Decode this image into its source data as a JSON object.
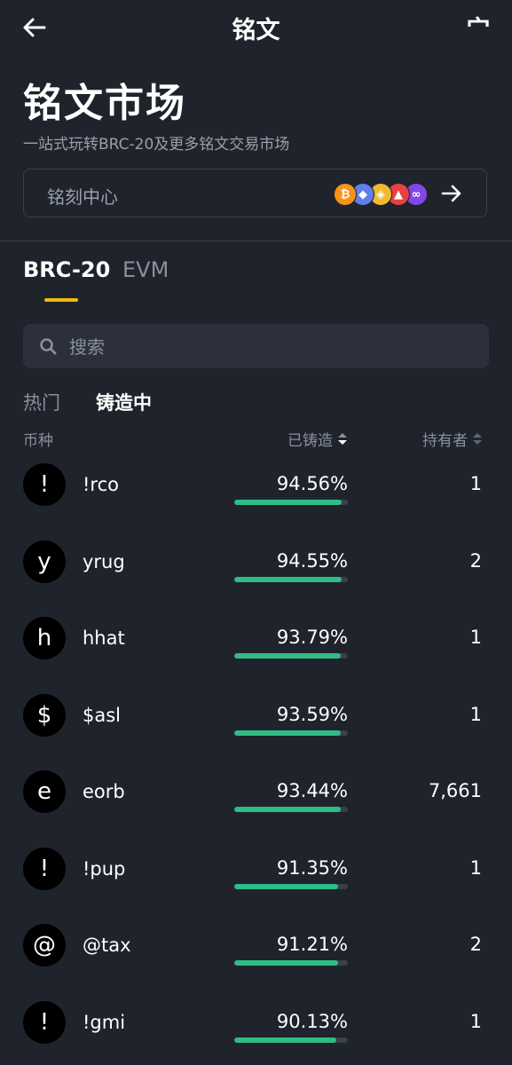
{
  "header": {
    "title": "铭文",
    "right_icon_glyph": "宀"
  },
  "hero": {
    "title": "铭文市场",
    "subtitle": "一站式玩转BRC-20及更多铭文交易市场"
  },
  "inscribe": {
    "label": "铭刻中心",
    "chains": [
      {
        "icon": "bitcoin-icon",
        "glyph": "₿",
        "color": "#f7931a"
      },
      {
        "icon": "ethereum-icon",
        "glyph": "◆",
        "color": "#627eea"
      },
      {
        "icon": "bnb-icon",
        "glyph": "◈",
        "color": "#f3ba2f"
      },
      {
        "icon": "avalanche-icon",
        "glyph": "▲",
        "color": "#e84142"
      },
      {
        "icon": "polygon-icon",
        "glyph": "∞",
        "color": "#8247e5"
      }
    ]
  },
  "tabs": [
    {
      "label": "BRC-20",
      "active": true
    },
    {
      "label": "EVM",
      "active": false
    }
  ],
  "search": {
    "placeholder": "搜索"
  },
  "subtabs": [
    {
      "label": "热门",
      "active": false
    },
    {
      "label": "铸造中",
      "active": true
    }
  ],
  "columns": {
    "coin": "币种",
    "minted": "已铸造",
    "holders": "持有者"
  },
  "tokens": [
    {
      "avatar": "!",
      "ticker": "!rco",
      "minted_percent": "94.56%",
      "progress": 94.56,
      "holders": "1"
    },
    {
      "avatar": "y",
      "ticker": "yrug",
      "minted_percent": "94.55%",
      "progress": 94.55,
      "holders": "2"
    },
    {
      "avatar": "h",
      "ticker": "hhat",
      "minted_percent": "93.79%",
      "progress": 93.79,
      "holders": "1"
    },
    {
      "avatar": "$",
      "ticker": "$asl",
      "minted_percent": "93.59%",
      "progress": 93.59,
      "holders": "1"
    },
    {
      "avatar": "e",
      "ticker": "eorb",
      "minted_percent": "93.44%",
      "progress": 93.44,
      "holders": "7,661"
    },
    {
      "avatar": "!",
      "ticker": "!pup",
      "minted_percent": "91.35%",
      "progress": 91.35,
      "holders": "1"
    },
    {
      "avatar": "@",
      "ticker": "@tax",
      "minted_percent": "91.21%",
      "progress": 91.21,
      "holders": "2"
    },
    {
      "avatar": "!",
      "ticker": "!gmi",
      "minted_percent": "90.13%",
      "progress": 90.13,
      "holders": "1"
    }
  ],
  "colors": {
    "background": "#1f232c",
    "accent": "#f0b90b",
    "progress": "#2ebd85"
  }
}
